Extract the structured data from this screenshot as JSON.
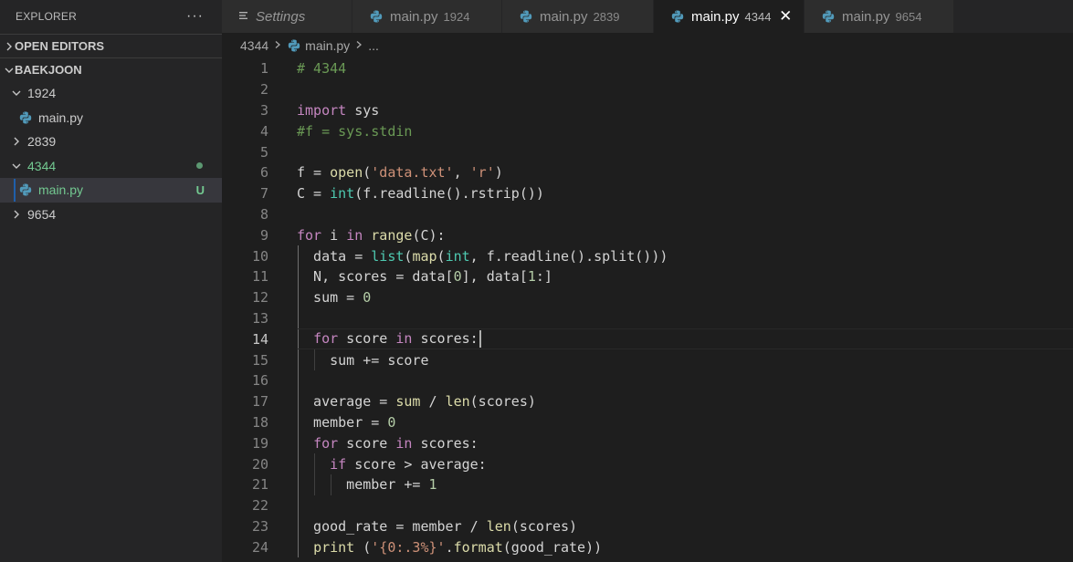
{
  "sidebar": {
    "title": "EXPLORER",
    "more": "···",
    "sections": [
      {
        "label": "OPEN EDITORS"
      },
      {
        "label": "BAEKJOON"
      }
    ],
    "tree": [
      {
        "label": "1924",
        "type": "folder",
        "expanded": true
      },
      {
        "label": "main.py",
        "type": "file"
      },
      {
        "label": "2839",
        "type": "folder",
        "expanded": false
      },
      {
        "label": "4344",
        "type": "folder",
        "expanded": true,
        "status": "modified"
      },
      {
        "label": "main.py",
        "type": "file",
        "status_letter": "U",
        "selected": true
      },
      {
        "label": "9654",
        "type": "folder",
        "expanded": false
      }
    ]
  },
  "tabs": [
    {
      "label": "Settings",
      "desc": ""
    },
    {
      "label": "main.py",
      "desc": "1924"
    },
    {
      "label": "main.py",
      "desc": "2839"
    },
    {
      "label": "main.py",
      "desc": "4344",
      "active": true
    },
    {
      "label": "main.py",
      "desc": "9654"
    }
  ],
  "tab_close_glyph": "✕",
  "breadcrumb": {
    "folder": "4344",
    "file": "main.py",
    "more": "..."
  },
  "editor": {
    "line_numbers": [
      "1",
      "2",
      "3",
      "4",
      "5",
      "6",
      "7",
      "8",
      "9",
      "10",
      "11",
      "12",
      "13",
      "14",
      "15",
      "16",
      "17",
      "18",
      "19",
      "20",
      "21",
      "22",
      "23",
      "24"
    ],
    "current_line": 14,
    "lines": [
      [
        [
          "cm",
          "# 4344"
        ]
      ],
      [],
      [
        [
          "kw",
          "import"
        ],
        [
          "pl",
          " sys"
        ]
      ],
      [
        [
          "cm",
          "#f = sys.stdin"
        ]
      ],
      [],
      [
        [
          "pl",
          "f = "
        ],
        [
          "fn",
          "open"
        ],
        [
          "pl",
          "("
        ],
        [
          "st",
          "'data.txt'"
        ],
        [
          "pl",
          ", "
        ],
        [
          "st",
          "'r'"
        ],
        [
          "pl",
          ")"
        ]
      ],
      [
        [
          "pl",
          "C = "
        ],
        [
          "bi",
          "int"
        ],
        [
          "pl",
          "(f.readline().rstrip())"
        ]
      ],
      [],
      [
        [
          "kw",
          "for"
        ],
        [
          "pl",
          " i "
        ],
        [
          "kw",
          "in"
        ],
        [
          "pl",
          " "
        ],
        [
          "fn",
          "range"
        ],
        [
          "pl",
          "(C):"
        ]
      ],
      [
        [
          "pl",
          "  data = "
        ],
        [
          "bi",
          "list"
        ],
        [
          "pl",
          "("
        ],
        [
          "fn",
          "map"
        ],
        [
          "pl",
          "("
        ],
        [
          "bi",
          "int"
        ],
        [
          "pl",
          ", f.readline().split()))"
        ]
      ],
      [
        [
          "pl",
          "  N, scores = data["
        ],
        [
          "nu",
          "0"
        ],
        [
          "pl",
          "], data["
        ],
        [
          "nu",
          "1"
        ],
        [
          "pl",
          ":]"
        ]
      ],
      [
        [
          "pl",
          "  sum = "
        ],
        [
          "nu",
          "0"
        ]
      ],
      [],
      [
        [
          "pl",
          "  "
        ],
        [
          "kw",
          "for"
        ],
        [
          "pl",
          " score "
        ],
        [
          "kw",
          "in"
        ],
        [
          "pl",
          " scores:"
        ]
      ],
      [
        [
          "pl",
          "    sum += score"
        ]
      ],
      [],
      [
        [
          "pl",
          "  average = "
        ],
        [
          "fn",
          "sum"
        ],
        [
          "pl",
          " / "
        ],
        [
          "fn",
          "len"
        ],
        [
          "pl",
          "(scores)"
        ]
      ],
      [
        [
          "pl",
          "  member = "
        ],
        [
          "nu",
          "0"
        ]
      ],
      [
        [
          "pl",
          "  "
        ],
        [
          "kw",
          "for"
        ],
        [
          "pl",
          " score "
        ],
        [
          "kw",
          "in"
        ],
        [
          "pl",
          " scores:"
        ]
      ],
      [
        [
          "pl",
          "    "
        ],
        [
          "kw",
          "if"
        ],
        [
          "pl",
          " score > average:"
        ]
      ],
      [
        [
          "pl",
          "      member += "
        ],
        [
          "nu",
          "1"
        ]
      ],
      [],
      [
        [
          "pl",
          "  good_rate = member / "
        ],
        [
          "fn",
          "len"
        ],
        [
          "pl",
          "(scores)"
        ]
      ],
      [
        [
          "pl",
          "  "
        ],
        [
          "fn",
          "print"
        ],
        [
          "pl",
          " ("
        ],
        [
          "st",
          "'{0:.3%}'"
        ],
        [
          "pl",
          "."
        ],
        [
          "fn",
          "format"
        ],
        [
          "pl",
          "(good_rate))"
        ]
      ]
    ]
  }
}
